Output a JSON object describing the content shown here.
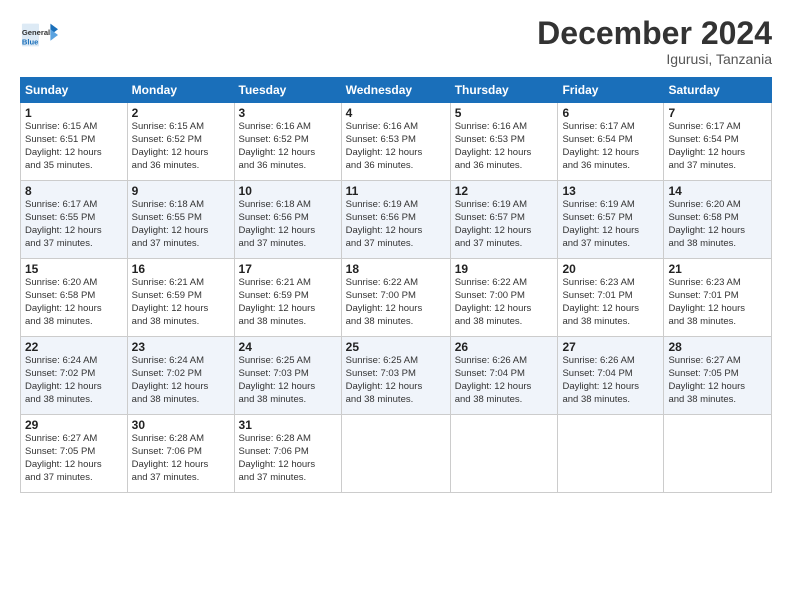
{
  "header": {
    "logo_general": "General",
    "logo_blue": "Blue",
    "month_title": "December 2024",
    "location": "Igurusi, Tanzania"
  },
  "weekdays": [
    "Sunday",
    "Monday",
    "Tuesday",
    "Wednesday",
    "Thursday",
    "Friday",
    "Saturday"
  ],
  "weeks": [
    [
      {
        "day": "1",
        "info": "Sunrise: 6:15 AM\nSunset: 6:51 PM\nDaylight: 12 hours\nand 35 minutes."
      },
      {
        "day": "2",
        "info": "Sunrise: 6:15 AM\nSunset: 6:52 PM\nDaylight: 12 hours\nand 36 minutes."
      },
      {
        "day": "3",
        "info": "Sunrise: 6:16 AM\nSunset: 6:52 PM\nDaylight: 12 hours\nand 36 minutes."
      },
      {
        "day": "4",
        "info": "Sunrise: 6:16 AM\nSunset: 6:53 PM\nDaylight: 12 hours\nand 36 minutes."
      },
      {
        "day": "5",
        "info": "Sunrise: 6:16 AM\nSunset: 6:53 PM\nDaylight: 12 hours\nand 36 minutes."
      },
      {
        "day": "6",
        "info": "Sunrise: 6:17 AM\nSunset: 6:54 PM\nDaylight: 12 hours\nand 36 minutes."
      },
      {
        "day": "7",
        "info": "Sunrise: 6:17 AM\nSunset: 6:54 PM\nDaylight: 12 hours\nand 37 minutes."
      }
    ],
    [
      {
        "day": "8",
        "info": "Sunrise: 6:17 AM\nSunset: 6:55 PM\nDaylight: 12 hours\nand 37 minutes."
      },
      {
        "day": "9",
        "info": "Sunrise: 6:18 AM\nSunset: 6:55 PM\nDaylight: 12 hours\nand 37 minutes."
      },
      {
        "day": "10",
        "info": "Sunrise: 6:18 AM\nSunset: 6:56 PM\nDaylight: 12 hours\nand 37 minutes."
      },
      {
        "day": "11",
        "info": "Sunrise: 6:19 AM\nSunset: 6:56 PM\nDaylight: 12 hours\nand 37 minutes."
      },
      {
        "day": "12",
        "info": "Sunrise: 6:19 AM\nSunset: 6:57 PM\nDaylight: 12 hours\nand 37 minutes."
      },
      {
        "day": "13",
        "info": "Sunrise: 6:19 AM\nSunset: 6:57 PM\nDaylight: 12 hours\nand 37 minutes."
      },
      {
        "day": "14",
        "info": "Sunrise: 6:20 AM\nSunset: 6:58 PM\nDaylight: 12 hours\nand 38 minutes."
      }
    ],
    [
      {
        "day": "15",
        "info": "Sunrise: 6:20 AM\nSunset: 6:58 PM\nDaylight: 12 hours\nand 38 minutes."
      },
      {
        "day": "16",
        "info": "Sunrise: 6:21 AM\nSunset: 6:59 PM\nDaylight: 12 hours\nand 38 minutes."
      },
      {
        "day": "17",
        "info": "Sunrise: 6:21 AM\nSunset: 6:59 PM\nDaylight: 12 hours\nand 38 minutes."
      },
      {
        "day": "18",
        "info": "Sunrise: 6:22 AM\nSunset: 7:00 PM\nDaylight: 12 hours\nand 38 minutes."
      },
      {
        "day": "19",
        "info": "Sunrise: 6:22 AM\nSunset: 7:00 PM\nDaylight: 12 hours\nand 38 minutes."
      },
      {
        "day": "20",
        "info": "Sunrise: 6:23 AM\nSunset: 7:01 PM\nDaylight: 12 hours\nand 38 minutes."
      },
      {
        "day": "21",
        "info": "Sunrise: 6:23 AM\nSunset: 7:01 PM\nDaylight: 12 hours\nand 38 minutes."
      }
    ],
    [
      {
        "day": "22",
        "info": "Sunrise: 6:24 AM\nSunset: 7:02 PM\nDaylight: 12 hours\nand 38 minutes."
      },
      {
        "day": "23",
        "info": "Sunrise: 6:24 AM\nSunset: 7:02 PM\nDaylight: 12 hours\nand 38 minutes."
      },
      {
        "day": "24",
        "info": "Sunrise: 6:25 AM\nSunset: 7:03 PM\nDaylight: 12 hours\nand 38 minutes."
      },
      {
        "day": "25",
        "info": "Sunrise: 6:25 AM\nSunset: 7:03 PM\nDaylight: 12 hours\nand 38 minutes."
      },
      {
        "day": "26",
        "info": "Sunrise: 6:26 AM\nSunset: 7:04 PM\nDaylight: 12 hours\nand 38 minutes."
      },
      {
        "day": "27",
        "info": "Sunrise: 6:26 AM\nSunset: 7:04 PM\nDaylight: 12 hours\nand 38 minutes."
      },
      {
        "day": "28",
        "info": "Sunrise: 6:27 AM\nSunset: 7:05 PM\nDaylight: 12 hours\nand 38 minutes."
      }
    ],
    [
      {
        "day": "29",
        "info": "Sunrise: 6:27 AM\nSunset: 7:05 PM\nDaylight: 12 hours\nand 37 minutes."
      },
      {
        "day": "30",
        "info": "Sunrise: 6:28 AM\nSunset: 7:06 PM\nDaylight: 12 hours\nand 37 minutes."
      },
      {
        "day": "31",
        "info": "Sunrise: 6:28 AM\nSunset: 7:06 PM\nDaylight: 12 hours\nand 37 minutes."
      },
      null,
      null,
      null,
      null
    ]
  ]
}
